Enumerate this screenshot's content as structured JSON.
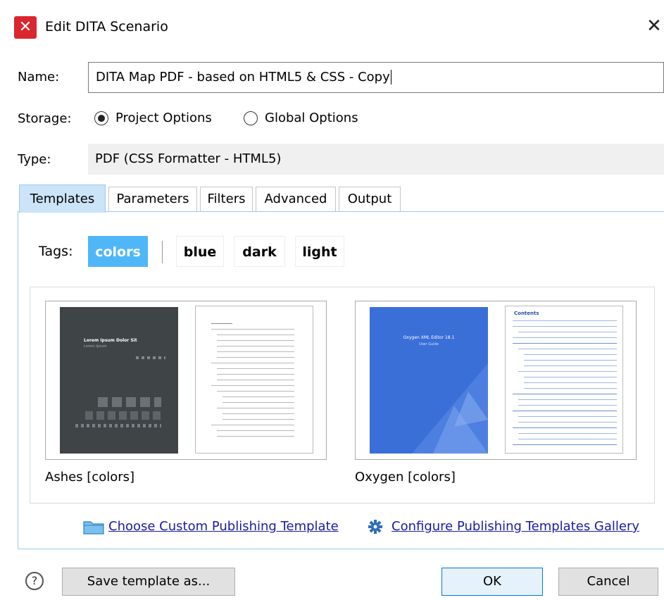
{
  "window": {
    "title": "Edit DITA Scenario",
    "app_icon": "x-icon",
    "close_glyph": "✕"
  },
  "form": {
    "name_label": "Name:",
    "name_value": "DITA Map PDF - based on HTML5 & CSS - Copy",
    "storage_label": "Storage:",
    "storage_options": [
      {
        "label": "Project Options",
        "selected": true
      },
      {
        "label": "Global Options",
        "selected": false
      }
    ],
    "type_label": "Type:",
    "type_value": "PDF (CSS Formatter - HTML5)"
  },
  "tabs": [
    {
      "label": "Templates",
      "active": true
    },
    {
      "label": "Parameters",
      "active": false
    },
    {
      "label": "Filters",
      "active": false
    },
    {
      "label": "Advanced",
      "active": false
    },
    {
      "label": "Output",
      "active": false
    }
  ],
  "tags": {
    "label": "Tags:",
    "items": [
      {
        "label": "colors",
        "active": true
      },
      {
        "label": "blue",
        "active": false
      },
      {
        "label": "dark",
        "active": false
      },
      {
        "label": "light",
        "active": false
      }
    ]
  },
  "templates": [
    {
      "label": "Ashes [colors]",
      "cover_color": "#3f4447",
      "cover_title": "Lorem Ipsum Dolor Sit",
      "cover_subtitle": "Lorem Ipsum"
    },
    {
      "label": "Oxygen [colors]",
      "cover_color": "#3a6fd8",
      "cover_title": "Oxygen XML Editor 18.1",
      "cover_subtitle": "User Guide",
      "toc_title": "Contents"
    }
  ],
  "links": {
    "choose_custom": "Choose Custom Publishing Template",
    "configure_gallery": "Configure Publishing Templates Gallery"
  },
  "buttons": {
    "help": "?",
    "save_template": "Save template as...",
    "ok": "OK",
    "cancel": "Cancel"
  },
  "colors": {
    "accent": "#4fb7f8",
    "tab_active": "#cce4f7",
    "link": "#1a1aa6"
  }
}
